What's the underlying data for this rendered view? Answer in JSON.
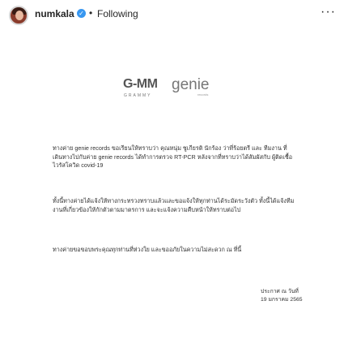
{
  "header": {
    "username": "numkala",
    "verified_icon": "verified-badge-icon",
    "separator": "•",
    "follow_label": "Following",
    "more_label": "···"
  },
  "logo": {
    "gmm_text": "G-MM",
    "gmm_sub": "GRAMMY",
    "genie_text": "genie",
    "genie_sub": "records"
  },
  "statement": {
    "paragraph_1": "ทางค่าย genie records ขอเรียนให้ทราบว่า คุณหนุ่ม ชูเกียรติ นักร้อง ว่าที่ร้อยตรี และ ทีมงาน ที่เดินทางไปกับค่าย genie records ได้ทำการตรวจ RT-PCR หลังจากที่ทราบว่าได้สัมผัสกับ ผู้ติดเชื้อไวรัสโควิด covid-19",
    "paragraph_2": "ทั้งนี้ทางค่ายได้แจ้งให้ทางกระทรวงทราบแล้วและขอแจ้งให้ทุกท่านได้ระมัดระวังตัว ทั้งนี้ได้แจ้งทีมงานที่เกี่ยวข้องให้กักตัวตามมาตรการ และจะแจ้งความคืบหน้าให้ทราบต่อไป",
    "paragraph_3": "ทางค่ายขอขอบพระคุณทุกท่านที่ห่วงใย และขออภัยในความไม่สะดวก ณ ที่นี้",
    "signature_line_1": "ประกาศ ณ วันที่",
    "signature_line_2": "19 มกราคม 2565"
  }
}
